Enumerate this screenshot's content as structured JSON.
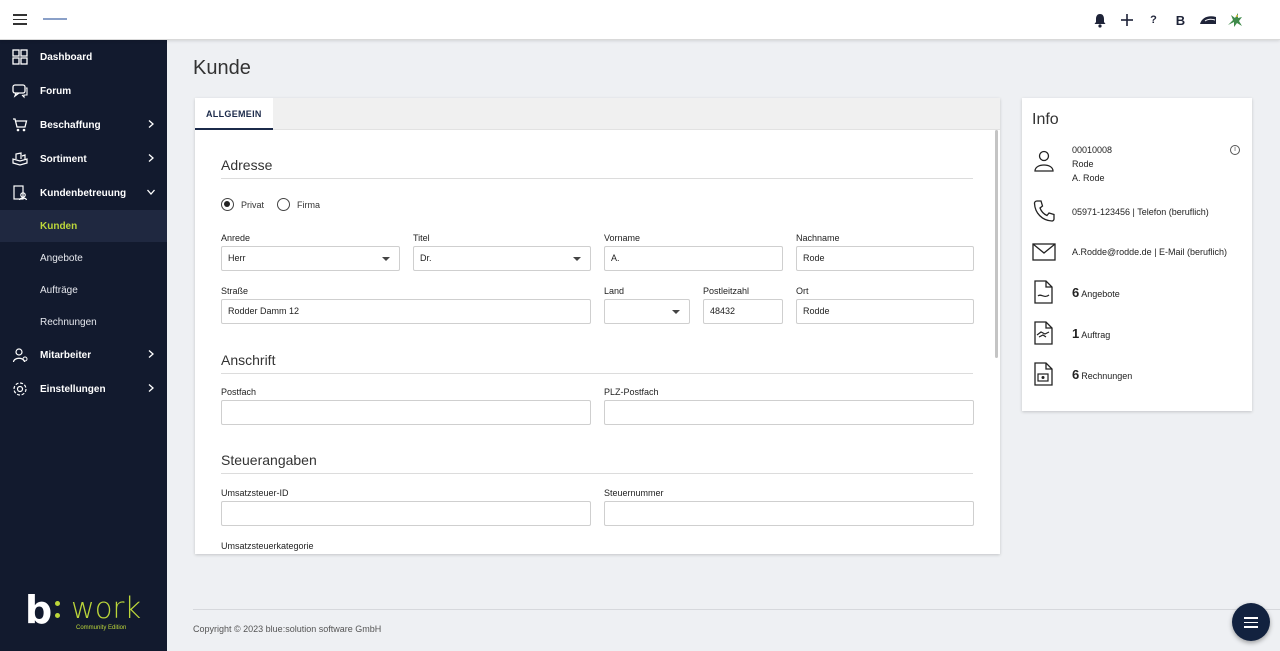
{
  "topbar": {
    "icons": [
      "bell-icon",
      "plus-icon",
      "help-icon",
      "b-logo-icon",
      "cap-icon",
      "dragon-icon"
    ],
    "help_label": "?",
    "b_label": "B"
  },
  "sidebar": {
    "items": [
      {
        "label": "Dashboard",
        "icon": "dashboard-icon"
      },
      {
        "label": "Forum",
        "icon": "forum-icon"
      },
      {
        "label": "Beschaffung",
        "icon": "cart-icon"
      },
      {
        "label": "Sortiment",
        "icon": "assortment-icon"
      },
      {
        "label": "Kundenbetreuung",
        "icon": "customer-care-icon"
      },
      {
        "label": "Mitarbeiter",
        "icon": "employee-icon"
      },
      {
        "label": "Einstellungen",
        "icon": "settings-icon"
      }
    ],
    "sub_items": [
      {
        "label": "Kunden"
      },
      {
        "label": "Angebote"
      },
      {
        "label": "Aufträge"
      },
      {
        "label": "Rechnungen"
      }
    ],
    "brand": {
      "b": "b",
      "work": "work",
      "edition": "Community Edition"
    },
    "accent": "#bcd63a",
    "background": "#121a2e"
  },
  "main": {
    "title": "Kunde",
    "tab": "ALLGEMEIN",
    "sections": {
      "adresse": "Adresse",
      "anschrift": "Anschrift",
      "steuer": "Steuerangaben"
    },
    "radio": {
      "privat": "Privat",
      "firma": "Firma",
      "selected": "Privat"
    },
    "labels": {
      "anrede": "Anrede",
      "titel": "Titel",
      "vorname": "Vorname",
      "nachname": "Nachname",
      "strasse": "Straße",
      "land": "Land",
      "plz": "Postleitzahl",
      "ort": "Ort",
      "postfach": "Postfach",
      "plz_postfach": "PLZ-Postfach",
      "ust_id": "Umsatzsteuer-ID",
      "steuernummer": "Steuernummer",
      "ust_kat": "Umsatzsteuerkategorie"
    },
    "values": {
      "anrede": "Herr",
      "titel": "Dr.",
      "vorname": "A.",
      "nachname": "Rode",
      "strasse": "Rodder Damm 12",
      "land": "",
      "plz": "48432",
      "ort": "Rodde",
      "postfach": "",
      "plz_postfach": "",
      "ust_id": "",
      "steuernummer": ""
    }
  },
  "info": {
    "title": "Info",
    "customer_no": "00010008",
    "customer_name": "Rode",
    "contact_name": "A. Rode",
    "phone": "05971-123456 | Telefon (beruflich)",
    "email": "A.Rodde@rodde.de | E-Mail (beruflich)",
    "offers_count": "6",
    "offers_label": "Angebote",
    "orders_count": "1",
    "orders_label": "Auftrag",
    "invoices_count": "6",
    "invoices_label": "Rechnungen",
    "info_symbol": "i"
  },
  "footer": {
    "copyright": "Copyright © 2023 blue:solution software GmbH"
  }
}
